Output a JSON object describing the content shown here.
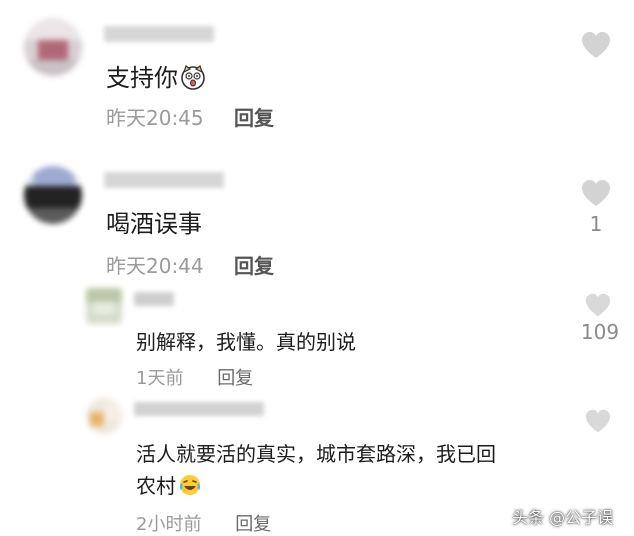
{
  "comments": [
    {
      "text": "支持你",
      "emoji_icon": "shocked-cat-face-icon",
      "time": "昨天20:45",
      "reply_label": "回复",
      "likes": ""
    },
    {
      "text": "喝酒误事",
      "time": "昨天20:44",
      "reply_label": "回复",
      "likes": "1",
      "replies": [
        {
          "text": "别解释，我懂。真的别说",
          "time": "1天前",
          "reply_label": "回复",
          "likes": "109"
        },
        {
          "text_line1": "活人就要活的真实，城市套路深，我已回",
          "text_line2": "农村",
          "emoji_icon": "laughing-tears-emoji-icon",
          "time": "2小时前",
          "reply_label": "回复",
          "likes": ""
        }
      ]
    }
  ],
  "watermark": {
    "text": "头条 @公子误"
  },
  "colors": {
    "text": "#1c1c1c",
    "meta": "#9b9b9b",
    "heart": "#d3d3d3"
  }
}
